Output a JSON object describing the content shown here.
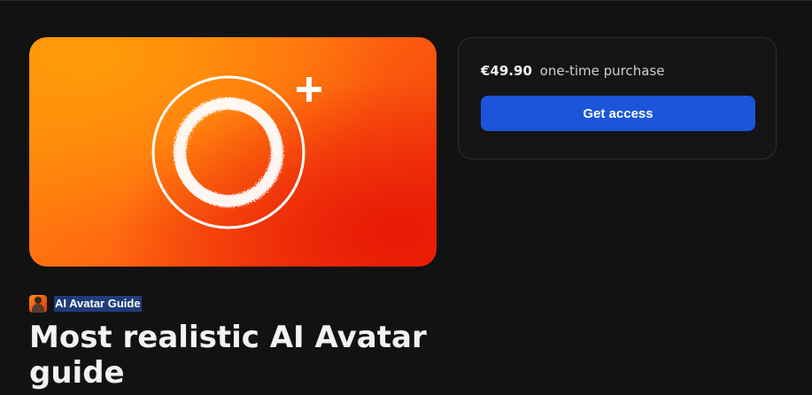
{
  "product": {
    "title": "Most realistic AI Avatar guide",
    "creator_name": "AI Avatar Guide",
    "cover_icon": "ring-plus-icon"
  },
  "pricing": {
    "price": "€49.90",
    "price_note": "one-time purchase",
    "cta_label": "Get access"
  },
  "colors": {
    "background": "#121212",
    "accent_button": "#1b55d9",
    "cover_orange": "#ff8f0c",
    "cover_red": "#e81806"
  }
}
